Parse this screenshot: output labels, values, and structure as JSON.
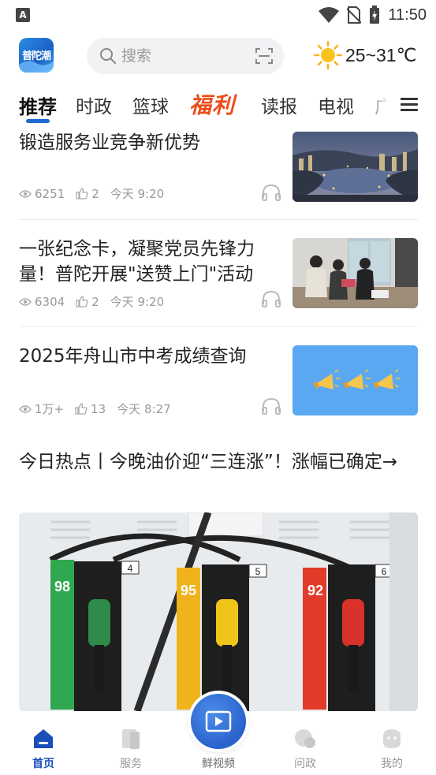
{
  "status_bar": {
    "notification_glyph": "A",
    "time": "11:50",
    "icons": [
      "wifi-icon",
      "no-sim-icon",
      "battery-charging-icon"
    ]
  },
  "header": {
    "logo_text": "普陀潮",
    "search_placeholder": "搜索",
    "weather_icon": "sun-icon",
    "temperature": "25~31℃"
  },
  "tabs": [
    {
      "label": "推荐",
      "active": true
    },
    {
      "label": "时政"
    },
    {
      "label": "篮球"
    },
    {
      "label": "福利",
      "highlight": true
    },
    {
      "label": "读报"
    },
    {
      "label": "电视"
    },
    {
      "label": "广"
    }
  ],
  "feed": [
    {
      "title": "锻造服务业竞争新优势",
      "views": "6251",
      "likes": "2",
      "time": "今天  9:20",
      "thumbnail": "city-lake-night-photo"
    },
    {
      "title": "一张纪念卡，凝聚党员先锋力量！普陀开展\"送赞上门\"活动",
      "views": "6304",
      "likes": "2",
      "time": "今天  9:20",
      "thumbnail": "office-people-photo"
    },
    {
      "title": "2025年舟山市中考成绩查询",
      "views": "1万+",
      "likes": "13",
      "time": "今天  8:27",
      "thumbnail": "megaphones-on-blue"
    }
  ],
  "featured": {
    "title": "今日热点丨今晚油价迎“三连涨”！涨幅已确定→",
    "image": "fuel-pump-nozzles-photo",
    "pump_labels": [
      "98",
      "4",
      "95",
      "5",
      "92",
      "6"
    ]
  },
  "bottom_nav": {
    "items": [
      {
        "label": "首页",
        "icon": "home-icon",
        "active": true
      },
      {
        "label": "服务",
        "icon": "service-icon"
      },
      {
        "label": "鲜视频",
        "icon": "video-play-icon"
      },
      {
        "label": "问政",
        "icon": "ask-gov-icon"
      },
      {
        "label": "我的",
        "icon": "profile-icon"
      }
    ]
  },
  "colors": {
    "accent": "#1f6bd6",
    "highlight_tab": "#ec4d1c",
    "meta_text": "#999999",
    "thumb_blue": "#5aa8f2"
  }
}
